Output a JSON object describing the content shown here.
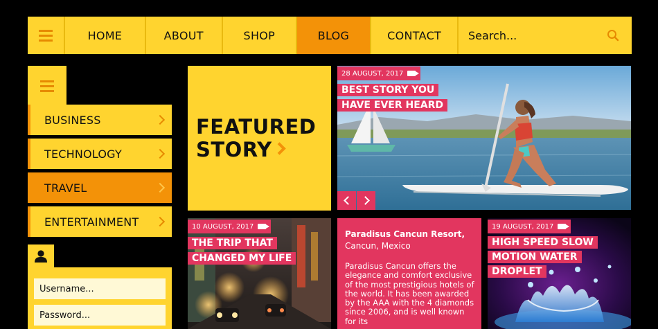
{
  "nav": {
    "items": [
      {
        "label": "HOME"
      },
      {
        "label": "ABOUT"
      },
      {
        "label": "SHOP"
      },
      {
        "label": "BLOG",
        "active": true
      },
      {
        "label": "CONTACT"
      }
    ],
    "search_placeholder": "Search..."
  },
  "sidebar": {
    "items": [
      {
        "label": "BUSINESS"
      },
      {
        "label": "TECHNOLOGY"
      },
      {
        "label": "TRAVEL",
        "active": true
      },
      {
        "label": "ENTERTAINMENT"
      }
    ]
  },
  "login": {
    "username_placeholder": "Username...",
    "password_placeholder": "Password..."
  },
  "featured": {
    "line1": "FEATURED",
    "line2": "STORY"
  },
  "hero": {
    "date": "28 AUGUST, 2017",
    "headline_line1": "BEST STORY YOU",
    "headline_line2": "HAVE EVER HEARD"
  },
  "tiles": {
    "city": {
      "date": "10 AUGUST, 2017",
      "headline_line1": "THE TRIP THAT",
      "headline_line2": "CHANGED MY LIFE"
    },
    "resort": {
      "name": "Paradisus Cancun Resort,",
      "location": "Cancun, Mexico",
      "description": "Paradisus Cancun offers the elegance and comfort exclusive of the most prestigious hotels of the world. It has been awarded by the AAA with the 4 diamonds since 2006, and is well known for its"
    },
    "splash": {
      "date": "19 AUGUST, 2017",
      "headline_line1": "HIGH SPEED SLOW",
      "headline_line2": "MOTION WATER",
      "headline_line3": "DROPLET"
    }
  },
  "colors": {
    "yellow": "#ffd42f",
    "orange": "#f39208",
    "pink": "#e2365f",
    "background": "#000000"
  }
}
